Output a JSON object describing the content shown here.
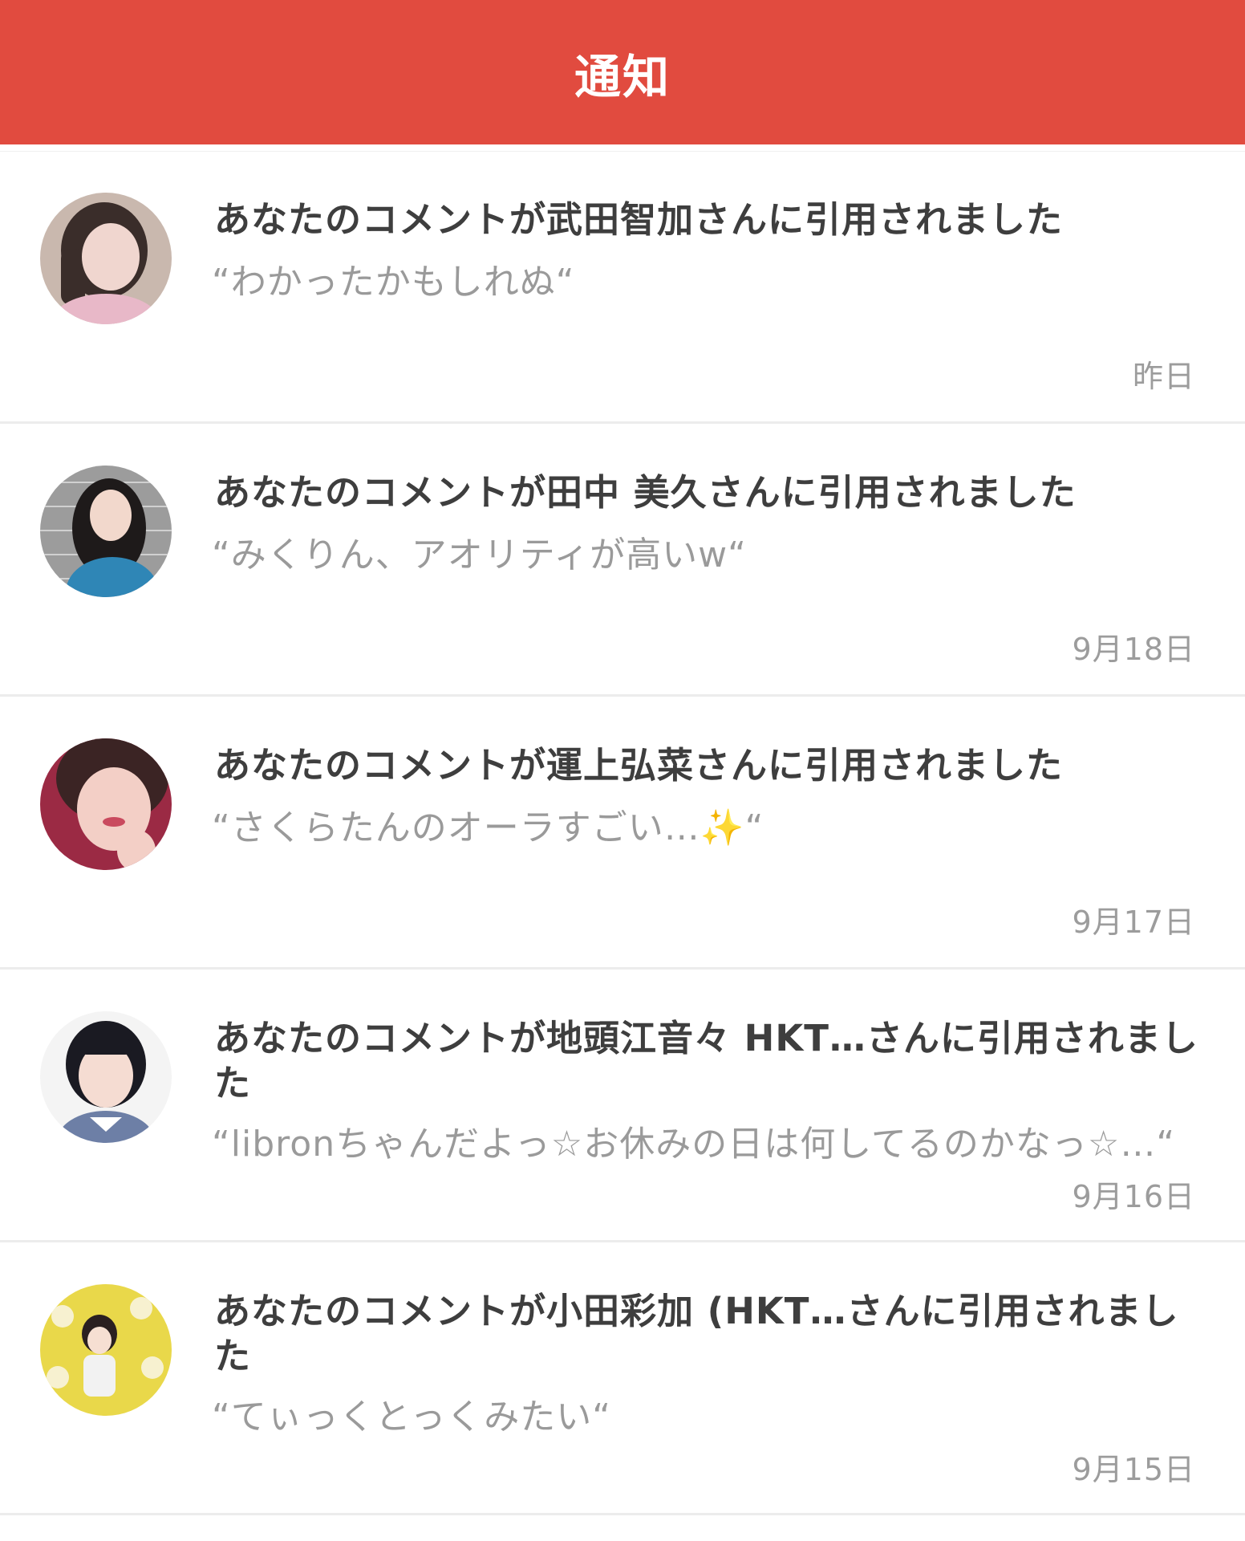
{
  "header": {
    "title": "通知"
  },
  "notifications": [
    {
      "title": "あなたのコメントが武田智加さんに引用されました",
      "quote": "“わかったかもしれぬ“",
      "date": "昨日",
      "avatar_icon": "profile-photo-icon",
      "avatar_colors": [
        "#c9b8ae",
        "#3a2d2a",
        "#f0d6cf",
        "#e8b8c8"
      ]
    },
    {
      "title": "あなたのコメントが田中 美久さんに引用されました",
      "quote": "“みくりん、アオリティが高いw“",
      "date": "9月18日",
      "avatar_icon": "profile-photo-icon",
      "avatar_colors": [
        "#9c9c9c",
        "#1e1a1a",
        "#f2d8cc",
        "#2f86b6"
      ]
    },
    {
      "title": "あなたのコメントが運上弘菜さんに引用されました",
      "quote": "“さくらたんのオーラすごい…✨“",
      "date": "9月17日",
      "avatar_icon": "profile-photo-icon",
      "avatar_colors": [
        "#9b2a44",
        "#3b2424",
        "#f3cfc6",
        "#c94a5e"
      ]
    },
    {
      "title": "あなたのコメントが地頭江音々 HKT…さんに引用されました",
      "quote": "“libronちゃんだよっ☆お休みの日は何してるのかなっ☆…“",
      "date": "9月16日",
      "avatar_icon": "profile-photo-icon",
      "avatar_colors": [
        "#f4f4f4",
        "#1a1a22",
        "#f5dcd2",
        "#6d7fa6"
      ]
    },
    {
      "title": "あなたのコメントが小田彩加 (HKT…さんに引用されました",
      "quote": "“てぃっくとっくみたい“",
      "date": "9月15日",
      "avatar_icon": "profile-photo-icon",
      "avatar_colors": [
        "#e9d84a",
        "#2a2020",
        "#f6dfd2",
        "#f2f2f2"
      ]
    }
  ]
}
